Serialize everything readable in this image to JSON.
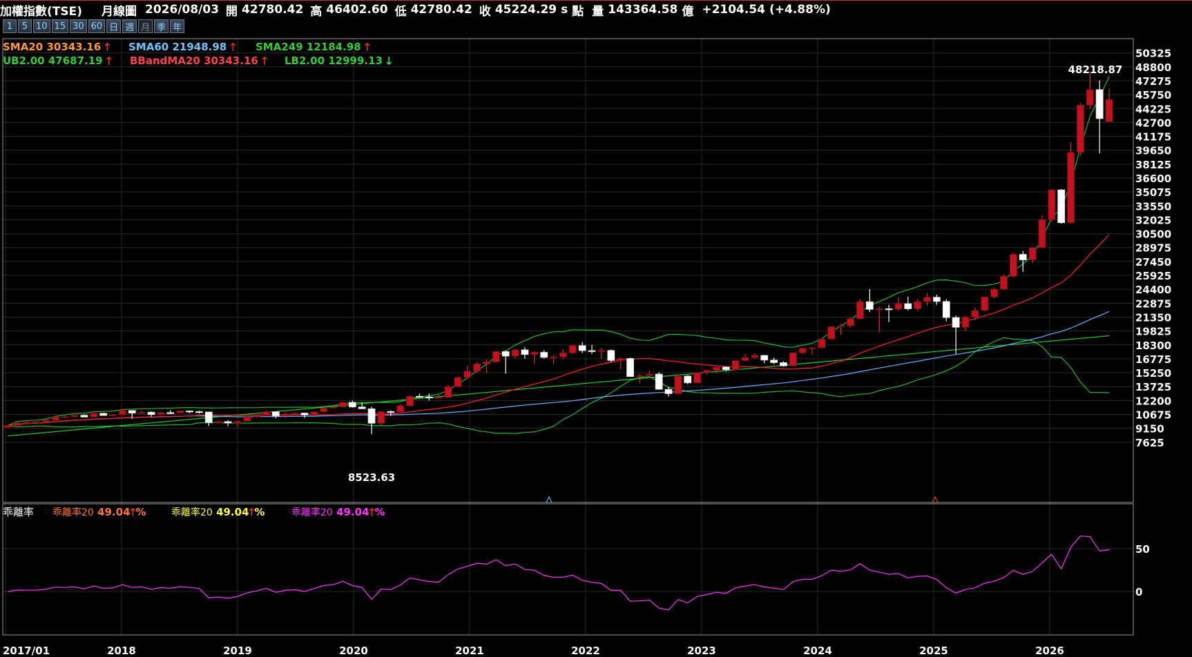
{
  "header": {
    "symbol": "加權指數(TSE)",
    "chart_kind": "月線圖",
    "date": "2026/08/03",
    "open_label": "開",
    "open": "42780.42",
    "high_label": "高",
    "high": "46402.60",
    "low_label": "低",
    "low": "42780.42",
    "close_label": "收",
    "close": "45224.29",
    "close_suffix": "s",
    "unit_point": "點",
    "volume_label": "量",
    "volume": "143364.58",
    "unit_volume": "億",
    "change": "+2104.54",
    "change_pct": "(+4.88%)"
  },
  "periods": [
    {
      "label": "1",
      "active": false
    },
    {
      "label": "5",
      "active": false
    },
    {
      "label": "10",
      "active": false
    },
    {
      "label": "15",
      "active": false
    },
    {
      "label": "30",
      "active": false
    },
    {
      "label": "60",
      "active": false
    },
    {
      "label": "日",
      "active": false
    },
    {
      "label": "週",
      "active": false
    },
    {
      "label": "月",
      "active": true
    },
    {
      "label": "季",
      "active": false
    },
    {
      "label": "年",
      "active": false
    }
  ],
  "legend_main": {
    "sma20": {
      "label": "SMA20",
      "value": "30343.16",
      "dir": "up",
      "color": "#ff9933"
    },
    "sma60": {
      "label": "SMA60",
      "value": "21948.98",
      "dir": "up",
      "color": "#6ec6ff"
    },
    "sma249": {
      "label": "SMA249",
      "value": "12184.98",
      "dir": "up",
      "color": "#33cc33"
    },
    "ub": {
      "label": "UB2.00",
      "value": "47687.19",
      "dir": "up",
      "color": "#33cc33"
    },
    "bband": {
      "label": "BBandMA20",
      "value": "30343.16",
      "dir": "up",
      "color": "#ff4444"
    },
    "lb": {
      "label": "LB2.00",
      "value": "12999.13",
      "dir": "down",
      "color": "#33cc33"
    }
  },
  "legend_sub": {
    "title": "乖離率",
    "items": [
      {
        "label": "乖離率20",
        "value": "49.04",
        "dir": "up",
        "color": "#ff7733"
      },
      {
        "label": "乖離率20",
        "value": "49.04",
        "dir": "up",
        "color": "#ffff33"
      },
      {
        "label": "乖離率20",
        "value": "49.04",
        "dir": "up",
        "color": "#ff33ff"
      }
    ]
  },
  "annotations": {
    "high_marker": "48218.87",
    "low_marker": "8523.63"
  },
  "colors": {
    "bg": "#000000",
    "grid": "#2a2a2a",
    "frame": "#aaaaaa",
    "up_candle": "#c1121f",
    "down_candle": "#ffffff",
    "sma20_line": "#ff2222",
    "sma60_line": "#5fb4ff",
    "sma249_line": "#22cc22",
    "band_line": "#22bb22",
    "bias_line": "#ff33ff"
  },
  "chart_data": {
    "type": "candlestick",
    "period": "monthly",
    "y_ticks": [
      50325,
      48800,
      47275,
      45750,
      44225,
      42700,
      41175,
      39650,
      38125,
      36600,
      35075,
      33550,
      32025,
      30500,
      28975,
      27450,
      25925,
      24400,
      22875,
      21350,
      19825,
      18300,
      16775,
      15250,
      13725,
      12200,
      10675,
      9150,
      7625
    ],
    "x_ticks": [
      "2017/01",
      "2018",
      "2019",
      "2020",
      "2021",
      "2022",
      "2023",
      "2024",
      "2025",
      "2026"
    ],
    "sub_y_ticks": [
      50,
      0
    ],
    "bars": [
      {
        "d": "2017/01",
        "o": 9254,
        "h": 9464,
        "l": 9233,
        "c": 9447
      },
      {
        "d": "2017/02",
        "o": 9447,
        "h": 9720,
        "l": 9420,
        "c": 9750
      },
      {
        "d": "2017/03",
        "o": 9740,
        "h": 9910,
        "l": 9700,
        "c": 9811
      },
      {
        "d": "2017/04",
        "o": 9811,
        "h": 9950,
        "l": 9620,
        "c": 9872
      },
      {
        "d": "2017/05",
        "o": 9872,
        "h": 10100,
        "l": 9850,
        "c": 10040
      },
      {
        "d": "2017/06",
        "o": 10040,
        "h": 10390,
        "l": 10020,
        "c": 10395
      },
      {
        "d": "2017/07",
        "o": 10395,
        "h": 10520,
        "l": 10290,
        "c": 10427
      },
      {
        "d": "2017/08",
        "o": 10427,
        "h": 10580,
        "l": 10330,
        "c": 10585
      },
      {
        "d": "2017/09",
        "o": 10585,
        "h": 10670,
        "l": 10400,
        "c": 10383
      },
      {
        "d": "2017/10",
        "o": 10383,
        "h": 10800,
        "l": 10380,
        "c": 10794
      },
      {
        "d": "2017/11",
        "o": 10794,
        "h": 10850,
        "l": 10550,
        "c": 10560
      },
      {
        "d": "2017/12",
        "o": 10560,
        "h": 10700,
        "l": 10470,
        "c": 10642
      },
      {
        "d": "2018/01",
        "o": 10642,
        "h": 11270,
        "l": 10630,
        "c": 11103
      },
      {
        "d": "2018/02",
        "o": 11103,
        "h": 11120,
        "l": 10190,
        "c": 10815
      },
      {
        "d": "2018/03",
        "o": 10815,
        "h": 11080,
        "l": 10700,
        "c": 10919
      },
      {
        "d": "2018/04",
        "o": 10919,
        "h": 11010,
        "l": 10450,
        "c": 10657
      },
      {
        "d": "2018/05",
        "o": 10657,
        "h": 11000,
        "l": 10600,
        "c": 10875
      },
      {
        "d": "2018/06",
        "o": 10875,
        "h": 11150,
        "l": 10700,
        "c": 10836
      },
      {
        "d": "2018/07",
        "o": 10836,
        "h": 11100,
        "l": 10800,
        "c": 11057
      },
      {
        "d": "2018/08",
        "o": 11057,
        "h": 11100,
        "l": 10800,
        "c": 10989
      },
      {
        "d": "2018/09",
        "o": 10989,
        "h": 11070,
        "l": 10770,
        "c": 10940
      },
      {
        "d": "2018/10",
        "o": 10940,
        "h": 10990,
        "l": 9400,
        "c": 9773
      },
      {
        "d": "2018/11",
        "o": 9773,
        "h": 10000,
        "l": 9670,
        "c": 9888
      },
      {
        "d": "2018/12",
        "o": 9888,
        "h": 10050,
        "l": 9400,
        "c": 9727
      },
      {
        "d": "2019/01",
        "o": 9727,
        "h": 9950,
        "l": 9320,
        "c": 9932
      },
      {
        "d": "2019/02",
        "o": 9932,
        "h": 10300,
        "l": 9900,
        "c": 10389
      },
      {
        "d": "2019/03",
        "o": 10389,
        "h": 10650,
        "l": 10300,
        "c": 10641
      },
      {
        "d": "2019/04",
        "o": 10641,
        "h": 11100,
        "l": 10600,
        "c": 10967
      },
      {
        "d": "2019/05",
        "o": 10967,
        "h": 10980,
        "l": 10250,
        "c": 10498
      },
      {
        "d": "2019/06",
        "o": 10498,
        "h": 10900,
        "l": 10300,
        "c": 10730
      },
      {
        "d": "2019/07",
        "o": 10730,
        "h": 10900,
        "l": 10700,
        "c": 10823
      },
      {
        "d": "2019/08",
        "o": 10823,
        "h": 10850,
        "l": 10300,
        "c": 10618
      },
      {
        "d": "2019/09",
        "o": 10618,
        "h": 11000,
        "l": 10600,
        "c": 10956
      },
      {
        "d": "2019/10",
        "o": 10956,
        "h": 11400,
        "l": 10900,
        "c": 11367
      },
      {
        "d": "2019/11",
        "o": 11367,
        "h": 11600,
        "l": 11350,
        "c": 11489
      },
      {
        "d": "2019/12",
        "o": 11489,
        "h": 12000,
        "l": 11450,
        "c": 11997
      },
      {
        "d": "2020/01",
        "o": 11997,
        "h": 12200,
        "l": 11400,
        "c": 11495
      },
      {
        "d": "2020/02",
        "o": 11495,
        "h": 12000,
        "l": 11300,
        "c": 11292
      },
      {
        "d": "2020/03",
        "o": 11292,
        "h": 11500,
        "l": 8523.63,
        "c": 9708
      },
      {
        "d": "2020/04",
        "o": 9708,
        "h": 10600,
        "l": 9500,
        "c": 10992
      },
      {
        "d": "2020/05",
        "o": 10992,
        "h": 11100,
        "l": 10500,
        "c": 10942
      },
      {
        "d": "2020/06",
        "o": 10942,
        "h": 11800,
        "l": 10900,
        "c": 11621
      },
      {
        "d": "2020/07",
        "o": 11621,
        "h": 12700,
        "l": 11550,
        "c": 12664
      },
      {
        "d": "2020/08",
        "o": 12664,
        "h": 12950,
        "l": 12500,
        "c": 12592
      },
      {
        "d": "2020/09",
        "o": 12592,
        "h": 12960,
        "l": 12200,
        "c": 12516
      },
      {
        "d": "2020/10",
        "o": 12516,
        "h": 12950,
        "l": 12500,
        "c": 12546
      },
      {
        "d": "2020/11",
        "o": 12546,
        "h": 13900,
        "l": 12500,
        "c": 13722
      },
      {
        "d": "2020/12",
        "o": 13722,
        "h": 14800,
        "l": 13700,
        "c": 14732
      },
      {
        "d": "2021/01",
        "o": 14732,
        "h": 16000,
        "l": 14700,
        "c": 15410
      },
      {
        "d": "2021/02",
        "o": 15410,
        "h": 16400,
        "l": 15200,
        "c": 16212
      },
      {
        "d": "2021/03",
        "o": 16212,
        "h": 16700,
        "l": 15200,
        "c": 16431
      },
      {
        "d": "2021/04",
        "o": 16431,
        "h": 17600,
        "l": 16400,
        "c": 17567
      },
      {
        "d": "2021/05",
        "o": 17567,
        "h": 17700,
        "l": 15150,
        "c": 17068
      },
      {
        "d": "2021/06",
        "o": 17068,
        "h": 17900,
        "l": 16800,
        "c": 17755
      },
      {
        "d": "2021/07",
        "o": 17755,
        "h": 18050,
        "l": 16800,
        "c": 17247
      },
      {
        "d": "2021/08",
        "o": 17247,
        "h": 17600,
        "l": 16200,
        "c": 17490
      },
      {
        "d": "2021/09",
        "o": 17490,
        "h": 17700,
        "l": 16800,
        "c": 16935
      },
      {
        "d": "2021/10",
        "o": 16935,
        "h": 17200,
        "l": 16200,
        "c": 16987
      },
      {
        "d": "2021/11",
        "o": 16987,
        "h": 17800,
        "l": 16800,
        "c": 17427
      },
      {
        "d": "2021/12",
        "o": 17427,
        "h": 18300,
        "l": 17300,
        "c": 18218
      },
      {
        "d": "2022/01",
        "o": 18218,
        "h": 18619,
        "l": 17400,
        "c": 17674
      },
      {
        "d": "2022/02",
        "o": 17674,
        "h": 18300,
        "l": 17300,
        "c": 17652
      },
      {
        "d": "2022/03",
        "o": 17652,
        "h": 18000,
        "l": 16800,
        "c": 17693
      },
      {
        "d": "2022/04",
        "o": 17693,
        "h": 17800,
        "l": 16400,
        "c": 16592
      },
      {
        "d": "2022/05",
        "o": 16592,
        "h": 16900,
        "l": 15600,
        "c": 16807
      },
      {
        "d": "2022/06",
        "o": 16807,
        "h": 16900,
        "l": 14800,
        "c": 14825
      },
      {
        "d": "2022/07",
        "o": 14825,
        "h": 15100,
        "l": 14100,
        "c": 14930
      },
      {
        "d": "2022/08",
        "o": 14930,
        "h": 15500,
        "l": 14700,
        "c": 15095
      },
      {
        "d": "2022/09",
        "o": 15095,
        "h": 15300,
        "l": 13700,
        "c": 13425
      },
      {
        "d": "2022/10",
        "o": 13425,
        "h": 13700,
        "l": 12629,
        "c": 12949
      },
      {
        "d": "2022/11",
        "o": 12949,
        "h": 14700,
        "l": 12900,
        "c": 14879
      },
      {
        "d": "2022/12",
        "o": 14879,
        "h": 15000,
        "l": 14000,
        "c": 14138
      },
      {
        "d": "2023/01",
        "o": 14138,
        "h": 15300,
        "l": 14100,
        "c": 15265
      },
      {
        "d": "2023/02",
        "o": 15265,
        "h": 15600,
        "l": 15050,
        "c": 15504
      },
      {
        "d": "2023/03",
        "o": 15504,
        "h": 15900,
        "l": 15200,
        "c": 15868
      },
      {
        "d": "2023/04",
        "o": 15868,
        "h": 15950,
        "l": 15400,
        "c": 15579
      },
      {
        "d": "2023/05",
        "o": 15579,
        "h": 16600,
        "l": 15500,
        "c": 16578
      },
      {
        "d": "2023/06",
        "o": 16578,
        "h": 17300,
        "l": 16500,
        "c": 16915
      },
      {
        "d": "2023/07",
        "o": 16915,
        "h": 17400,
        "l": 16800,
        "c": 17145
      },
      {
        "d": "2023/08",
        "o": 17145,
        "h": 17200,
        "l": 16300,
        "c": 16634
      },
      {
        "d": "2023/09",
        "o": 16634,
        "h": 16900,
        "l": 16200,
        "c": 16353
      },
      {
        "d": "2023/10",
        "o": 16353,
        "h": 16500,
        "l": 15900,
        "c": 16001
      },
      {
        "d": "2023/11",
        "o": 16001,
        "h": 17500,
        "l": 15950,
        "c": 17433
      },
      {
        "d": "2023/12",
        "o": 17433,
        "h": 17950,
        "l": 17300,
        "c": 17931
      },
      {
        "d": "2024/01",
        "o": 17931,
        "h": 18000,
        "l": 17250,
        "c": 18000
      },
      {
        "d": "2024/02",
        "o": 18000,
        "h": 18900,
        "l": 17900,
        "c": 18935
      },
      {
        "d": "2024/03",
        "o": 18935,
        "h": 20300,
        "l": 18900,
        "c": 20294
      },
      {
        "d": "2024/04",
        "o": 20294,
        "h": 20600,
        "l": 19400,
        "c": 20396
      },
      {
        "d": "2024/05",
        "o": 20396,
        "h": 21300,
        "l": 20200,
        "c": 21174
      },
      {
        "d": "2024/06",
        "o": 21174,
        "h": 23300,
        "l": 21100,
        "c": 23032
      },
      {
        "d": "2024/07",
        "o": 23032,
        "h": 24416,
        "l": 21900,
        "c": 22199
      },
      {
        "d": "2024/08",
        "o": 22199,
        "h": 22500,
        "l": 19662,
        "c": 22268
      },
      {
        "d": "2024/09",
        "o": 22268,
        "h": 22700,
        "l": 20800,
        "c": 22225
      },
      {
        "d": "2024/10",
        "o": 22225,
        "h": 23500,
        "l": 22000,
        "c": 22820
      },
      {
        "d": "2024/11",
        "o": 22820,
        "h": 23600,
        "l": 22100,
        "c": 22263
      },
      {
        "d": "2024/12",
        "o": 22263,
        "h": 23300,
        "l": 22000,
        "c": 23035
      },
      {
        "d": "2025/01",
        "o": 23035,
        "h": 24000,
        "l": 22600,
        "c": 23526
      },
      {
        "d": "2025/02",
        "o": 23526,
        "h": 23800,
        "l": 22700,
        "c": 23063
      },
      {
        "d": "2025/03",
        "o": 23063,
        "h": 23300,
        "l": 20900,
        "c": 21298
      },
      {
        "d": "2025/04",
        "o": 21298,
        "h": 21500,
        "l": 17307,
        "c": 20235
      },
      {
        "d": "2025/05",
        "o": 20235,
        "h": 21500,
        "l": 19800,
        "c": 21347
      },
      {
        "d": "2025/06",
        "o": 21347,
        "h": 22400,
        "l": 21000,
        "c": 22075
      },
      {
        "d": "2025/07",
        "o": 22075,
        "h": 23600,
        "l": 22000,
        "c": 23557
      },
      {
        "d": "2025/08",
        "o": 23557,
        "h": 24600,
        "l": 23400,
        "c": 24418
      },
      {
        "d": "2025/09",
        "o": 24418,
        "h": 26000,
        "l": 24300,
        "c": 25821
      },
      {
        "d": "2025/10",
        "o": 25821,
        "h": 28400,
        "l": 25700,
        "c": 28233
      },
      {
        "d": "2025/11",
        "o": 28233,
        "h": 28600,
        "l": 26300,
        "c": 27626
      },
      {
        "d": "2025/12",
        "o": 27626,
        "h": 28900,
        "l": 27300,
        "c": 28963
      },
      {
        "d": "2026/01",
        "o": 28963,
        "h": 32500,
        "l": 28900,
        "c": 32063
      },
      {
        "d": "2026/02",
        "o": 32063,
        "h": 35400,
        "l": 31800,
        "c": 35300
      },
      {
        "d": "2026/03",
        "o": 35300,
        "h": 35400,
        "l": 31600,
        "c": 31700
      },
      {
        "d": "2026/04",
        "o": 31700,
        "h": 40500,
        "l": 31600,
        "c": 39400
      },
      {
        "d": "2026/05",
        "o": 39400,
        "h": 44800,
        "l": 39100,
        "c": 44600
      },
      {
        "d": "2026/06",
        "o": 44600,
        "h": 48218.87,
        "l": 44200,
        "c": 46300
      },
      {
        "d": "2026/07",
        "o": 46300,
        "h": 47300,
        "l": 39300,
        "c": 43120
      },
      {
        "d": "2026/08",
        "o": 42780.42,
        "h": 46402.6,
        "l": 42780.42,
        "c": 45224.29
      }
    ]
  }
}
